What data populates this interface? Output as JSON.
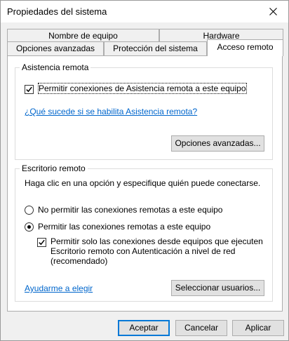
{
  "window": {
    "title": "Propiedades del sistema"
  },
  "tabs": {
    "row_back": [
      "Nombre de equipo",
      "Hardware"
    ],
    "row_front": [
      "Opciones avanzadas",
      "Protección del sistema",
      "Acceso remoto"
    ],
    "active": "Acceso remoto"
  },
  "remote_assistance": {
    "legend": "Asistencia remota",
    "allow_checkbox_label": "Permitir conexiones de Asistencia remota a este equipo",
    "allow_checked": true,
    "help_link": "¿Qué sucede si se habilita Asistencia remota?",
    "advanced_button": "Opciones avanzadas..."
  },
  "remote_desktop": {
    "legend": "Escritorio remoto",
    "instruction": "Haga clic en una opción y especifique quién puede conectarse.",
    "option_deny": "No permitir las conexiones remotas a este equipo",
    "option_allow": "Permitir las conexiones remotas a este equipo",
    "selected_option": "allow",
    "nla_checkbox_lines": [
      "Permitir solo las conexiones desde equipos que ejecuten",
      "Escritorio remoto con Autenticación a nivel de red",
      "(recomendado)"
    ],
    "nla_checked": true,
    "help_link": "Ayudarme a elegir",
    "select_users_button": "Seleccionar usuarios..."
  },
  "footer": {
    "ok": "Aceptar",
    "cancel": "Cancelar",
    "apply": "Aplicar"
  },
  "icons": {
    "close": "close-icon",
    "check": "checkmark-icon",
    "radio": "radio-dot-icon"
  },
  "colors": {
    "accent": "#0078d7",
    "link": "#0066cc"
  }
}
